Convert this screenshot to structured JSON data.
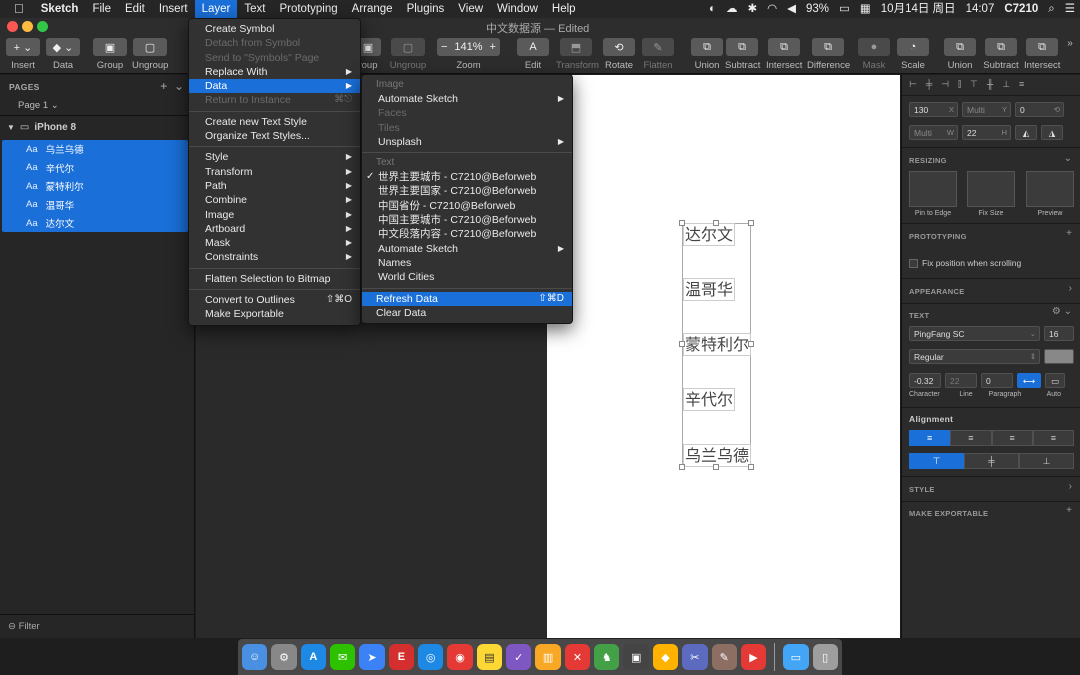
{
  "menubar": {
    "apple": "",
    "app": "Sketch",
    "items": [
      "File",
      "Edit",
      "Insert",
      "Layer",
      "Text",
      "Prototyping",
      "Arrange",
      "Plugins",
      "View",
      "Window",
      "Help"
    ],
    "active": "Layer",
    "status": {
      "battery": "93%",
      "date": "10月14日 周日",
      "time": "14:07",
      "user": "C7210"
    }
  },
  "window": {
    "title": "中文数据源 — Edited"
  },
  "toolbar": {
    "insert": "Insert",
    "data": "Data",
    "group": "Group",
    "ungroup": "Ungroup",
    "group2": "roup",
    "ungroup2": "Ungroup",
    "zoom": "Zoom",
    "zoom_value": "141%",
    "edit": "Edit",
    "transform": "Transform",
    "rotate": "Rotate",
    "flatten": "Flatten",
    "union": "Union",
    "subtract": "Subtract",
    "intersect": "Intersect",
    "difference": "Difference",
    "mask": "Mask",
    "scale": "Scale",
    "union2": "Union",
    "subtract2": "Subtract",
    "intersect2": "Intersect"
  },
  "sidebar": {
    "pages_header": "PAGES",
    "page": "Page 1",
    "artboard": "iPhone 8",
    "layer_prefix": "Aa",
    "layers": [
      "乌兰乌德",
      "辛代尔",
      "蒙特利尔",
      "温哥华",
      "达尔文"
    ],
    "filter": "Filter"
  },
  "canvas": {
    "texts": [
      "达尔文",
      "温哥华",
      "蒙特利尔",
      "辛代尔",
      "乌兰乌德"
    ]
  },
  "layer_menu": {
    "items": [
      {
        "label": "Create Symbol",
        "dis": false
      },
      {
        "label": "Detach from Symbol",
        "dis": true
      },
      {
        "label": "Send to \"Symbols\" Page",
        "dis": true
      },
      {
        "label": "Replace With",
        "dis": false,
        "sub": true
      },
      {
        "label": "Data",
        "dis": false,
        "sub": true,
        "hl": true
      },
      {
        "label": "Return to Instance",
        "dis": true,
        "sc": "⌘⎋"
      },
      {
        "sep": true
      },
      {
        "label": "Create new Text Style",
        "dis": false
      },
      {
        "label": "Organize Text Styles...",
        "dis": false
      },
      {
        "sep": true
      },
      {
        "label": "Style",
        "sub": true
      },
      {
        "label": "Transform",
        "sub": true
      },
      {
        "label": "Path",
        "sub": true
      },
      {
        "label": "Combine",
        "sub": true
      },
      {
        "label": "Image",
        "sub": true
      },
      {
        "label": "Artboard",
        "sub": true
      },
      {
        "label": "Mask",
        "sub": true
      },
      {
        "label": "Constraints",
        "sub": true
      },
      {
        "sep": true
      },
      {
        "label": "Flatten Selection to Bitmap"
      },
      {
        "sep": true
      },
      {
        "label": "Convert to Outlines",
        "sc": "⇧⌘O"
      },
      {
        "label": "Make Exportable"
      }
    ]
  },
  "data_menu": {
    "items": [
      {
        "hdr": "Image"
      },
      {
        "label": "Automate Sketch",
        "sub": true
      },
      {
        "label": "Faces",
        "dis": true
      },
      {
        "label": "Tiles",
        "dis": true
      },
      {
        "label": "Unsplash",
        "sub": true
      },
      {
        "sep": true
      },
      {
        "hdr": "Text"
      },
      {
        "label": "世界主要城市 - C7210@Beforweb",
        "chk": true
      },
      {
        "label": "世界主要国家 - C7210@Beforweb"
      },
      {
        "label": "中国省份 - C7210@Beforweb"
      },
      {
        "label": "中国主要城市 - C7210@Beforweb"
      },
      {
        "label": "中文段落内容 - C7210@Beforweb"
      },
      {
        "label": "Automate Sketch",
        "sub": true
      },
      {
        "label": "Names"
      },
      {
        "label": "World Cities"
      },
      {
        "sep": true
      },
      {
        "label": "Refresh Data",
        "sc": "⇧⌘D",
        "hl": true,
        "flush": true
      },
      {
        "label": "Clear Data",
        "flush": true
      }
    ]
  },
  "inspector": {
    "x": "130",
    "x_suf": "X",
    "y": "Multi",
    "y_suf": "Y",
    "rot": "0",
    "w": "Multi",
    "w_suf": "W",
    "h": "22",
    "h_suf": "H",
    "resizing": "RESIZING",
    "pin": "Pin to Edge",
    "fix": "Fix Size",
    "preview": "Preview",
    "prototyping": "PROTOTYPING",
    "fixpos": "Fix position when scrolling",
    "appearance": "APPEARANCE",
    "text": "TEXT",
    "font": "PingFang SC",
    "size": "16",
    "weight": "Regular",
    "char": "-0.32",
    "line": "22",
    "para": "0",
    "char_lbl": "Character",
    "line_lbl": "Line",
    "para_lbl": "Paragraph",
    "auto_lbl": "Auto",
    "alignment": "Alignment",
    "style": "STYLE",
    "export": "MAKE EXPORTABLE"
  },
  "colors": {
    "accent": "#1a6fd8"
  }
}
